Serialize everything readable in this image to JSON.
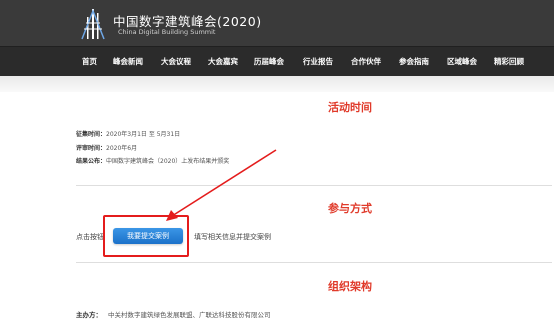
{
  "header": {
    "title": "中国数字建筑峰会(2020)",
    "subtitle": "China Digital Building Summit"
  },
  "nav": {
    "items": [
      "首页",
      "峰会新闻",
      "大会议程",
      "大会嘉宾",
      "历届峰会",
      "行业报告",
      "合作伙伴",
      "参会指南",
      "区域峰会",
      "精彩回顾"
    ]
  },
  "activity_time": {
    "title": "活动时间",
    "rows": [
      {
        "label": "征集时间：",
        "value": "2020年3月1日 至 5月31日"
      },
      {
        "label": "评审时间：",
        "value": "2020年6月"
      },
      {
        "label": "结果公布：",
        "value": "中国数字建筑峰会（2020）上发布结果并颁奖"
      }
    ]
  },
  "participation": {
    "title": "参与方式",
    "left_text": "点击按钮",
    "button_label": "我要提交案例",
    "right_text": "填写相关信息并提交案例"
  },
  "organization": {
    "title": "组织架构",
    "host_label": "主办方：",
    "host_value": "中关村数字建筑绿色发展联盟、广联达科技股份有限公司"
  },
  "colors": {
    "header_bg": "#3a3a3a",
    "nav_bg": "#2b2b2b",
    "accent_red": "#e03a2a",
    "button_blue": "#2a84d8",
    "highlight_red": "#e41c1c"
  }
}
